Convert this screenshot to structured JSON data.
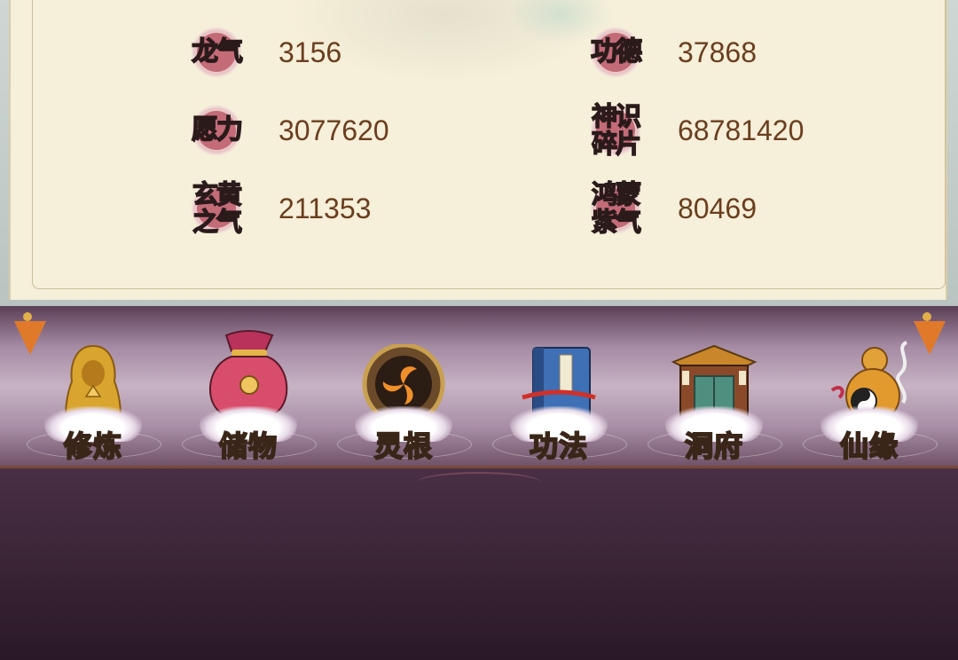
{
  "stats": [
    {
      "label": "龙气",
      "value": "3156"
    },
    {
      "label": "功德",
      "value": "37868"
    },
    {
      "label": "愿力",
      "value": "3077620"
    },
    {
      "label": "神识碎片",
      "label_lines": [
        "神识",
        "碎片"
      ],
      "value": "68781420"
    },
    {
      "label": "玄黄之气",
      "label_lines": [
        "玄黄",
        "之气"
      ],
      "value": "211353"
    },
    {
      "label": "鸿蒙紫气",
      "label_lines": [
        "鸿蒙",
        "紫气"
      ],
      "value": "80469"
    }
  ],
  "menu": [
    {
      "label": "修炼",
      "icon": "hooded-monk-icon"
    },
    {
      "label": "储物",
      "icon": "treasure-bag-icon"
    },
    {
      "label": "灵根",
      "icon": "spirit-root-disc-icon"
    },
    {
      "label": "功法",
      "icon": "scripture-book-icon"
    },
    {
      "label": "洞府",
      "icon": "cave-dwelling-gate-icon"
    },
    {
      "label": "仙缘",
      "icon": "gourd-taiji-icon"
    }
  ],
  "colors": {
    "value_text": "#6a3e1f",
    "badge": "#c46b78",
    "parchment": "#f6efd9",
    "menu_band": "#c7b3c4"
  }
}
